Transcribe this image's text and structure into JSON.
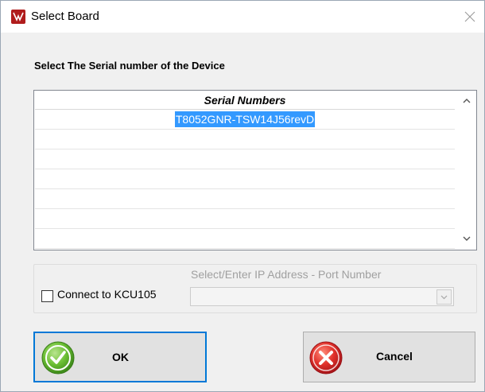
{
  "window": {
    "title": "Select Board"
  },
  "prompt": "Select The Serial number of the Device",
  "serial_list": {
    "header": "Serial Numbers",
    "rows": [
      "T8052GNR-TSW14J56revD",
      "",
      "",
      "",
      "",
      "",
      ""
    ],
    "selected_index": 0
  },
  "connection": {
    "ip_label": "Select/Enter IP Address - Port Number",
    "checkbox_label": "Connect to KCU105",
    "checkbox_checked": false,
    "ip_value": ""
  },
  "buttons": {
    "ok_label": "OK",
    "cancel_label": "Cancel"
  },
  "icons": {
    "app": "app-logo-icon",
    "close": "close-icon",
    "scroll_up": "chevron-up-icon",
    "scroll_down": "chevron-down-icon",
    "combo": "chevron-down-icon",
    "ok": "checkmark-icon",
    "cancel": "cross-icon"
  },
  "colors": {
    "selection": "#3399ff",
    "focus_border": "#0078d7",
    "ok_green": "#5cb82e",
    "cancel_red": "#d7282c",
    "app_icon": "#b01c1c"
  }
}
